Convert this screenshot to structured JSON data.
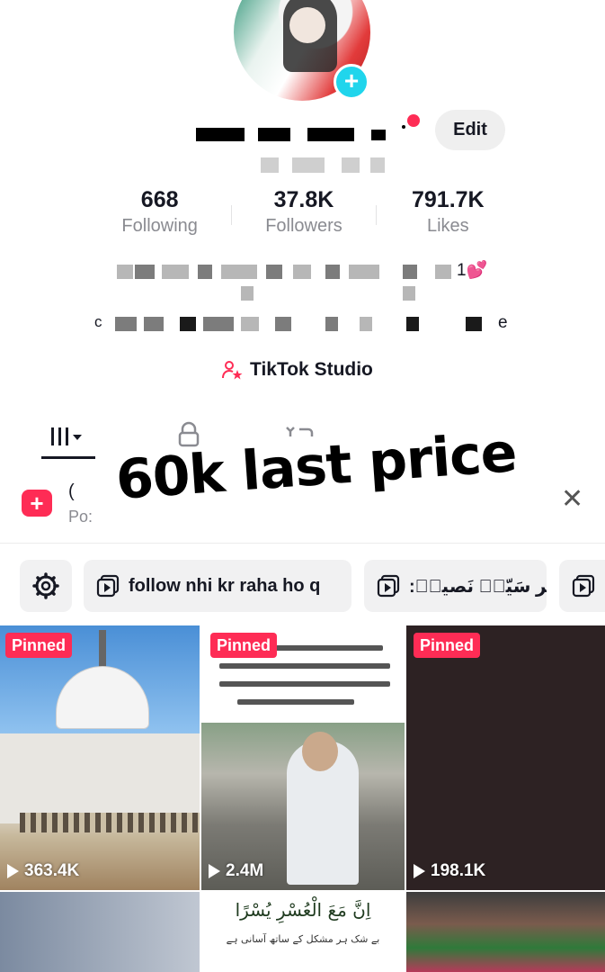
{
  "profile": {
    "edit_label": "Edit",
    "bio_suffix_1": "1💕",
    "bio_suffix_2": "e",
    "bio_prefix_2": "c"
  },
  "stats": [
    {
      "value": "668",
      "label": "Following"
    },
    {
      "value": "37.8K",
      "label": "Followers"
    },
    {
      "value": "791.7K",
      "label": "Likes"
    }
  ],
  "studio": {
    "label": "TikTok Studio"
  },
  "overlay": {
    "text": "60k last price"
  },
  "post_banner": {
    "title": "(",
    "subtitle": "Po:"
  },
  "chips": [
    {
      "label": "follow nhi kr raha ho q"
    },
    {
      "label": ":پیر سَیّدؔ نَصیرؔ"
    }
  ],
  "grid": {
    "pinned_label": "Pinned",
    "cells": [
      {
        "pinned": true,
        "views": "363.4K"
      },
      {
        "pinned": true,
        "views": "2.4M"
      },
      {
        "pinned": true,
        "views": "198.1K"
      }
    ],
    "cell5_title": "اِنَّ مَعَ الْعُسْرِ يُسْرًا",
    "cell5_sub": "بے شک ہر مشکل کے ساتھ آسانی ہے"
  },
  "colors": {
    "accent": "#fe2c55",
    "plus": "#20d5ec"
  }
}
